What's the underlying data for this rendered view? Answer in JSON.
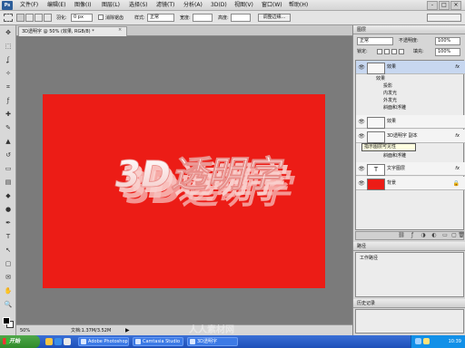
{
  "app": {
    "logo": "Ps",
    "menu": [
      "文件(F)",
      "编辑(E)",
      "图像(I)",
      "图层(L)",
      "选择(S)",
      "滤镜(T)",
      "分析(A)",
      "3D(D)",
      "视图(V)",
      "窗口(W)",
      "帮助(H)"
    ],
    "window_buttons": [
      "-",
      "□",
      "×"
    ]
  },
  "options_bar": {
    "feather_label": "羽化:",
    "feather_value": "0 px",
    "antialias_label": "消除锯齿",
    "style_label": "样式:",
    "style_value": "正常",
    "width_label": "宽度:",
    "height_label": "高度:",
    "refine_button": "调整边缘..."
  },
  "tools": {
    "icons": [
      "move-tool-icon",
      "marquee-tool-icon",
      "lasso-tool-icon",
      "magic-wand-tool-icon",
      "crop-tool-icon",
      "eyedropper-tool-icon",
      "healing-brush-tool-icon",
      "brush-tool-icon",
      "clone-stamp-tool-icon",
      "history-brush-tool-icon",
      "eraser-tool-icon",
      "gradient-tool-icon",
      "blur-tool-icon",
      "dodge-tool-icon",
      "pen-tool-icon",
      "type-tool-icon",
      "path-selection-tool-icon",
      "shape-tool-icon",
      "notes-tool-icon",
      "hand-tool-icon",
      "zoom-tool-icon"
    ],
    "glyphs": [
      "✥",
      "⬚",
      "ʆ",
      "✧",
      "⌗",
      "ƒ",
      "✚",
      "✎",
      "▲",
      "↺",
      "▭",
      "▤",
      "◆",
      "●",
      "✒",
      "T",
      "↖",
      "▢",
      "✉",
      "✋",
      "🔍"
    ]
  },
  "document": {
    "tab_title": "3D透明字 @ 50% (效果, RGB/8) *",
    "close": "×",
    "canvas_color": "#ec1c16",
    "text": "3D透明字"
  },
  "status": {
    "zoom": "50%",
    "doc_info": "文档:1.37M/3.52M"
  },
  "layers_panel": {
    "title": "图层",
    "blend_mode": "正常",
    "opacity_label": "不透明度:",
    "opacity_value": "100%",
    "lock_label": "锁定:",
    "fill_label": "填充:",
    "fill_value": "100%",
    "layers": [
      {
        "name": "效果",
        "fx": "fx",
        "selected": true
      },
      {
        "name": "效果",
        "fx": "",
        "selected": false
      },
      {
        "name": "3D透明字 副本",
        "fx": "fx",
        "selected": false
      },
      {
        "name": "文字图层",
        "fx": "fx",
        "selected": false
      },
      {
        "name": "背景",
        "fx": "",
        "selected": false
      }
    ],
    "effects": [
      "效果",
      "投影",
      "内发光",
      "外发光",
      "斜面和浮雕"
    ],
    "tooltip": "指示图层可见性",
    "sub_effect": "斜面和浮雕"
  },
  "paths_panel": {
    "title": "路径",
    "item": "工作路径"
  },
  "history_panel": {
    "title": "历史记录"
  },
  "taskbar": {
    "start": "开始",
    "tasks": [
      "Adobe Photoshop",
      "Camtasia Studio",
      "3D透明字"
    ],
    "clock": "10:39"
  },
  "watermark": "人人素材网"
}
